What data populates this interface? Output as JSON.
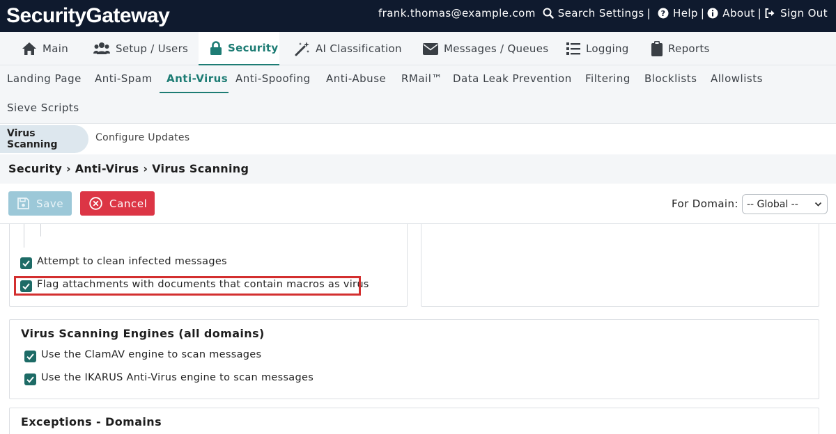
{
  "app": {
    "brand": "SecurityGateway",
    "user_email": "frank.thomas@example.com",
    "search_label": "Search Settings",
    "help_label": "Help",
    "about_label": "About",
    "signout_label": "Sign Out",
    "separator": "|"
  },
  "main_nav": [
    {
      "label": "Main",
      "icon": "home-icon"
    },
    {
      "label": "Setup / Users",
      "icon": "users-icon"
    },
    {
      "label": "Security",
      "icon": "lock-icon",
      "active": true
    },
    {
      "label": "AI Classification",
      "icon": "magic-wand-icon"
    },
    {
      "label": "Messages / Queues",
      "icon": "envelope-icon"
    },
    {
      "label": "Logging",
      "icon": "list-icon"
    },
    {
      "label": "Reports",
      "icon": "clipboard-icon"
    }
  ],
  "sub_nav": [
    {
      "label": "Landing Page"
    },
    {
      "label": "Anti-Spam"
    },
    {
      "label": "Anti-Virus",
      "active": true
    },
    {
      "label": "Anti-Spoofing"
    },
    {
      "label": "Anti-Abuse"
    },
    {
      "label": "RMail™"
    },
    {
      "label": "Data Leak Prevention"
    },
    {
      "label": "Filtering"
    },
    {
      "label": "Blocklists"
    },
    {
      "label": "Allowlists"
    },
    {
      "label": "Sieve Scripts"
    }
  ],
  "third_nav": [
    {
      "label": "Virus Scanning",
      "active": true
    },
    {
      "label": "Configure Updates"
    }
  ],
  "breadcrumb": "Security › Anti-Virus › Virus Scanning",
  "actions": {
    "save_label": "Save",
    "cancel_label": "Cancel",
    "domain_label": "For Domain:",
    "domain_value": "-- Global --"
  },
  "options": {
    "clean_infected": {
      "label": "Attempt to clean infected messages",
      "checked": true
    },
    "flag_macros": {
      "label": "Flag attachments with documents that contain macros as virus",
      "checked": true
    }
  },
  "engines": {
    "title": "Virus Scanning Engines (all domains)",
    "clamav": {
      "label": "Use the ClamAV engine to scan messages",
      "checked": true
    },
    "ikarus": {
      "label": "Use the IKARUS Anti-Virus engine to scan messages",
      "checked": true
    }
  },
  "exceptions": {
    "title": "Exceptions - Domains"
  },
  "colors": {
    "topbar": "#0f1a2e",
    "accent": "#1d7c74",
    "checkbox": "#1d6b66",
    "cancel": "#dc3545",
    "save_disabled": "#9cc8d8",
    "highlight": "#d32f2f"
  }
}
